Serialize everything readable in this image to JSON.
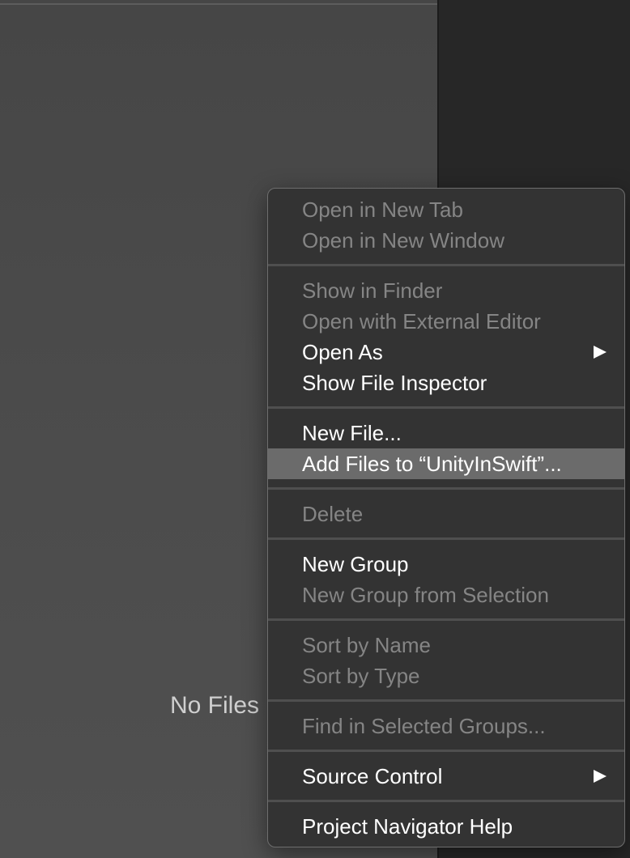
{
  "navigator": {
    "empty_label": "No Files"
  },
  "context_menu": {
    "items": [
      {
        "label": "Open in New Tab",
        "enabled": false
      },
      {
        "label": "Open in New Window",
        "enabled": false
      },
      {
        "label": "Show in Finder",
        "enabled": false
      },
      {
        "label": "Open with External Editor",
        "enabled": false
      },
      {
        "label": "Open As",
        "enabled": true,
        "submenu": true
      },
      {
        "label": "Show File Inspector",
        "enabled": true
      },
      {
        "label": "New File...",
        "enabled": true
      },
      {
        "label": "Add Files to “UnityInSwift”...",
        "enabled": true,
        "highlighted": true
      },
      {
        "label": "Delete",
        "enabled": false
      },
      {
        "label": "New Group",
        "enabled": true
      },
      {
        "label": "New Group from Selection",
        "enabled": false
      },
      {
        "label": "Sort by Name",
        "enabled": false
      },
      {
        "label": "Sort by Type",
        "enabled": false
      },
      {
        "label": "Find in Selected Groups...",
        "enabled": false
      },
      {
        "label": "Source Control",
        "enabled": true,
        "submenu": true
      },
      {
        "label": "Project Navigator Help",
        "enabled": true
      }
    ]
  },
  "colors": {
    "menu_background": "#333333",
    "highlight": "#6b6b6b",
    "enabled_text": "#ffffff",
    "disabled_text": "#858585"
  },
  "icons": {
    "submenu": "triangle-right-icon"
  }
}
